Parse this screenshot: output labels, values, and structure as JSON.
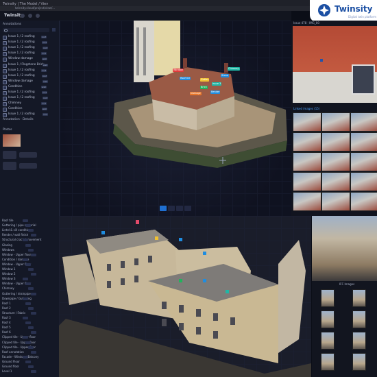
{
  "browser": {
    "tab_label": "Twinsity | The Model / Viev",
    "url": "twinsity.cloud/project/view/..."
  },
  "app": {
    "title": "Twinsity"
  },
  "logo": {
    "name": "Twinsity",
    "tagline": "Digital twin platform"
  },
  "left_panel_top": {
    "section_title": "Annotations",
    "layers": [
      {
        "label": "Issue 1 / 2 roofing",
        "tag": "roof"
      },
      {
        "label": "Issue 1 / 2 roofing",
        "tag": "roof"
      },
      {
        "label": "Issue 1 / 2 roofing",
        "tag": "roof"
      },
      {
        "label": "Issue 1 / 2 roofing",
        "tag": "roof"
      },
      {
        "label": "Window damage",
        "tag": "wall"
      },
      {
        "label": "Issue 1 / Flagstone Brick",
        "tag": "wall"
      },
      {
        "label": "Issue 1 / 2 roofing",
        "tag": "roof"
      },
      {
        "label": "Issue 1 / 2 roofing",
        "tag": "roof"
      },
      {
        "label": "Window damage",
        "tag": "wall"
      },
      {
        "label": "Condition",
        "tag": "wall"
      },
      {
        "label": "Issue 1 / 2 roofing",
        "tag": "roof"
      },
      {
        "label": "Issue 1 / 2 roofing",
        "tag": "roof"
      },
      {
        "label": "Chimney",
        "tag": "roof"
      },
      {
        "label": "Condition",
        "tag": "wall"
      },
      {
        "label": "Issue 1 / 2 roofing",
        "tag": "roof"
      }
    ],
    "details_title": "Annotation · Details",
    "details_sub": "Photos"
  },
  "right_panel_top": {
    "main_photo_title": "Issue 478 · IMG_00",
    "thumbnails_title": "Linked images (15)"
  },
  "right_panel_bottom": {
    "thumbnails_title": "IFC Images"
  },
  "left_panel_bottom": {
    "props": [
      "Roof tile",
      "Guttering / pipe material",
      "Lintel & sill condition",
      "Render / wall finish",
      "Structural crack / movement",
      "Glazing",
      "Windows",
      "Window - Upper floor",
      "Condition / damage",
      "Window - Upper floor",
      "Window 1",
      "Window 2",
      "Window 3",
      "Window - Upper floor",
      "Chimney",
      "Guttering / drainpipes",
      "Downpipe / Guttering",
      "Roof 1",
      "Roof 2",
      "Structure / Fabric",
      "Roof 3",
      "Roof 4",
      "Roof 5",
      "Roof 6",
      "Clipped tile - Upper floor",
      "Clipped tile - Upper floor",
      "Clipped tile - Upper floor",
      "Roof annotation",
      "Facade - Window / Balcony",
      "Ground Floor",
      "Ground floor",
      "Level 1"
    ]
  },
  "annotations_top": [
    {
      "text": "Window",
      "color": "#e23b3b"
    },
    {
      "text": "Roof tile",
      "color": "#1f8de0"
    },
    {
      "text": "Gutter",
      "color": "#f1c232"
    },
    {
      "text": "Issue 3",
      "color": "#1fb7a6"
    },
    {
      "text": "Stone",
      "color": "#1f8de0"
    },
    {
      "text": "Brick",
      "color": "#22b35d"
    },
    {
      "text": "Chimney",
      "color": "#1fb7a6"
    },
    {
      "text": "Damage",
      "color": "#e8762a"
    },
    {
      "text": "Render",
      "color": "#1f8de0"
    }
  ],
  "toolbar": [
    "select",
    "measure",
    "annotate",
    "settings"
  ]
}
